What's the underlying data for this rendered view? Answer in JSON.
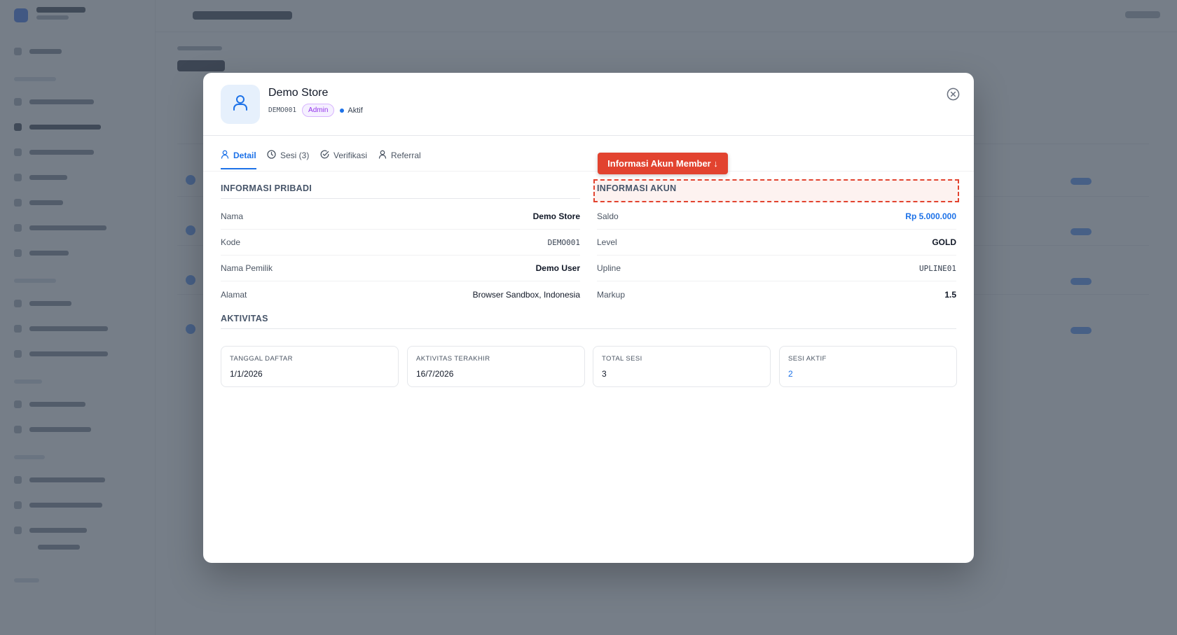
{
  "modal": {
    "title": "Demo Store",
    "code": "DEMO001",
    "role_badge": "Admin",
    "status": "Aktif",
    "tabs": [
      {
        "label": "Detail",
        "icon": "user-icon"
      },
      {
        "label": "Sesi (3)",
        "icon": "clock-icon"
      },
      {
        "label": "Verifikasi",
        "icon": "check-circle-icon"
      },
      {
        "label": "Referral",
        "icon": "user-icon"
      }
    ],
    "callout": "Informasi Akun Member ↓",
    "personal": {
      "title": "INFORMASI PRIBADI",
      "rows": [
        {
          "label": "Nama",
          "value": "Demo Store"
        },
        {
          "label": "Kode",
          "value": "DEMO001"
        },
        {
          "label": "Nama Pemilik",
          "value": "Demo User"
        },
        {
          "label": "Alamat",
          "value": "Browser Sandbox, Indonesia"
        }
      ]
    },
    "account": {
      "title": "INFORMASI AKUN",
      "rows": [
        {
          "label": "Saldo",
          "value": "Rp 5.000.000"
        },
        {
          "label": "Level",
          "value": "GOLD"
        },
        {
          "label": "Upline",
          "value": "UPLINE01"
        },
        {
          "label": "Markup",
          "value": "1.5"
        }
      ]
    },
    "activity": {
      "title": "AKTIVITAS",
      "cards": [
        {
          "label": "TANGGAL DAFTAR",
          "value": "1/1/2026"
        },
        {
          "label": "AKTIVITAS TERAKHIR",
          "value": "16/7/2026"
        },
        {
          "label": "TOTAL SESI",
          "value": "3"
        },
        {
          "label": "SESI AKTIF",
          "value": "2"
        }
      ]
    }
  },
  "colors": {
    "accent": "#1d72e8",
    "callout": "#e2432f",
    "badge": "#9333ea"
  }
}
